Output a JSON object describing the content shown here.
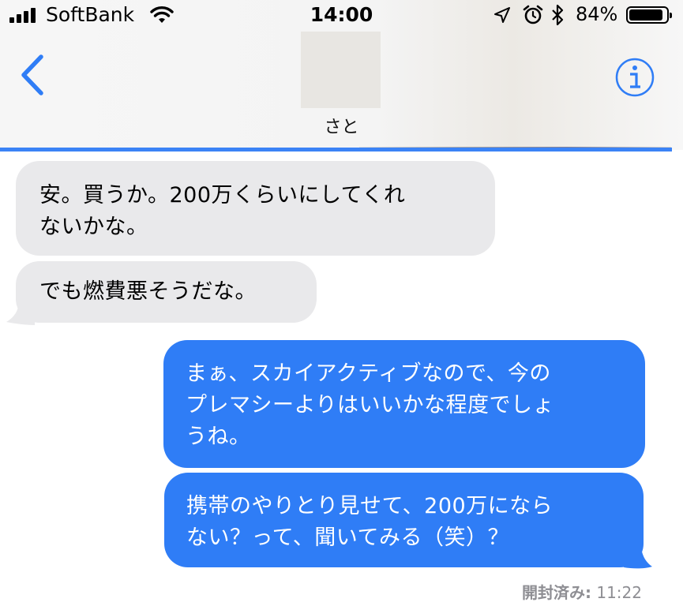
{
  "status_bar": {
    "carrier": "SoftBank",
    "time": "14:00",
    "battery_percent": "84%",
    "battery_level": 0.84,
    "icons": [
      "signal-icon",
      "wifi-icon",
      "location-arrow-icon",
      "alarm-icon",
      "bluetooth-icon",
      "battery-icon"
    ]
  },
  "header": {
    "contact_name": "さと",
    "back_icon": "chevron-left-icon",
    "info_icon": "info-icon"
  },
  "colors": {
    "accent": "#2f7df6",
    "incoming_bubble": "#e9e9eb",
    "receipt_text": "#8e8e93"
  },
  "messages": [
    {
      "direction": "incoming",
      "text": "安。買うか。200万くらいにしてくれ\nないかな。"
    },
    {
      "direction": "incoming",
      "text": "でも燃費悪そうだな。"
    },
    {
      "direction": "outgoing",
      "text": "まぁ、スカイアクティブなので、今の\nプレマシーよりはいいかな程度でしょ\nうね。"
    },
    {
      "direction": "outgoing",
      "text": "携帯のやりとり見せて、200万になら\nない？って、聞いてみる（笑）？"
    }
  ],
  "read_receipt": {
    "label": "開封済み:",
    "time": "11:22"
  }
}
